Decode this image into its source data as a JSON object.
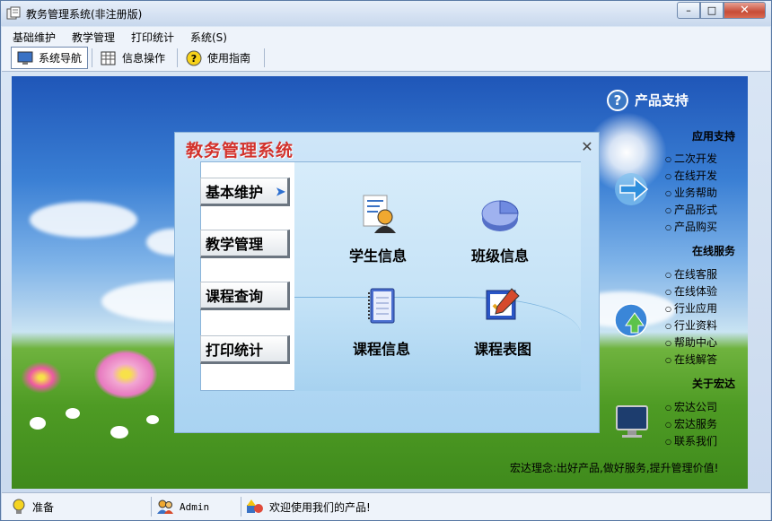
{
  "window": {
    "title": "教务管理系统(非注册版)",
    "min_label": "–",
    "max_label": "□",
    "close_label": "✕"
  },
  "menu": [
    "基础维护",
    "教学管理",
    "打印统计",
    "系统(S)"
  ],
  "toolbar": [
    {
      "label": "系统导航",
      "icon": "monitor-icon",
      "active": true
    },
    {
      "label": "信息操作",
      "icon": "grid-icon",
      "active": false
    },
    {
      "label": "使用指南",
      "icon": "help-icon",
      "active": false
    }
  ],
  "side": {
    "header": "产品支持",
    "sections": [
      {
        "title": "应用支持",
        "links": [
          "二次开发",
          "在线开发",
          "业务帮助",
          "产品形式",
          "产品购买"
        ]
      },
      {
        "title": "在线服务",
        "links": [
          "在线客服",
          "在线体验",
          "行业应用",
          "行业资料",
          "帮助中心",
          "在线解答"
        ]
      },
      {
        "title": "关于宏达",
        "links": [
          "宏达公司",
          "宏达服务",
          "联系我们"
        ]
      }
    ],
    "slogan": "宏达理念:出好产品,做好服务,提升管理价值!"
  },
  "dialog": {
    "title": "教务管理系统",
    "close": "✕",
    "nav": [
      "基本维护",
      "教学管理",
      "课程查询",
      "打印统计"
    ],
    "functions": [
      {
        "label": "学生信息",
        "icon": "student-icon"
      },
      {
        "label": "班级信息",
        "icon": "pie-chart-icon"
      },
      {
        "label": "课程信息",
        "icon": "notebook-icon"
      },
      {
        "label": "课程表图",
        "icon": "schedule-icon"
      }
    ]
  },
  "status": {
    "state": "准备",
    "user": "Admin",
    "message": "欢迎使用我们的产品!"
  }
}
